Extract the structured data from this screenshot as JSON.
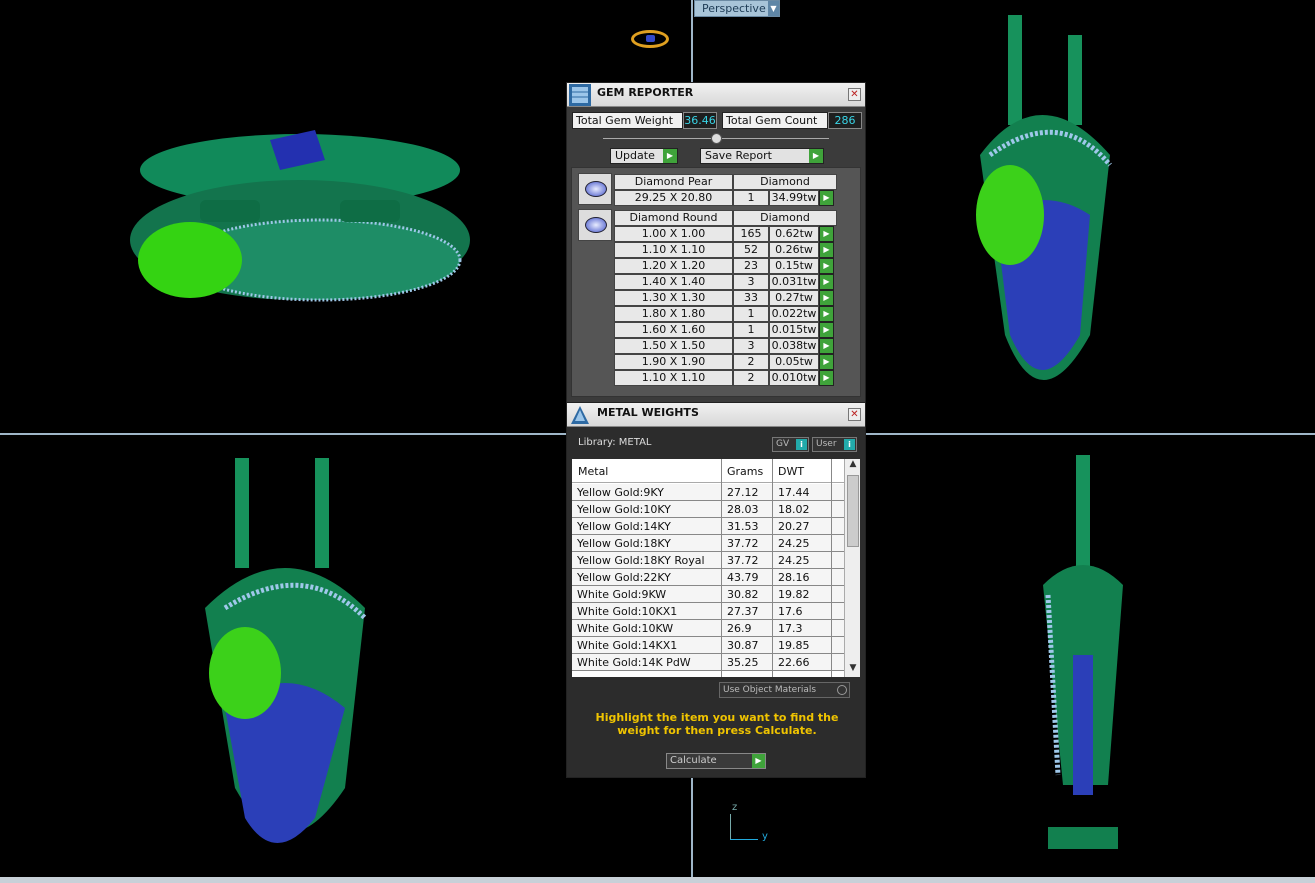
{
  "viewport": {
    "label": "Perspective",
    "axis_z": "z",
    "axis_y": "y"
  },
  "gem_reporter": {
    "title": "GEM REPORTER",
    "total_weight_label": "Total Gem Weight",
    "total_weight": "36.46",
    "total_count_label": "Total Gem Count",
    "total_count": "286",
    "update_label": "Update",
    "save_label": "Save Report",
    "pear": {
      "name": "Diamond Pear",
      "material": "Diamond",
      "size": "29.25 X 20.80",
      "qty": "1",
      "wt": "34.99tw"
    },
    "round": {
      "name": "Diamond Round",
      "material": "Diamond",
      "rows": [
        {
          "size": "1.00 X 1.00",
          "qty": "165",
          "wt": "0.62tw"
        },
        {
          "size": "1.10 X 1.10",
          "qty": "52",
          "wt": "0.26tw"
        },
        {
          "size": "1.20 X 1.20",
          "qty": "23",
          "wt": "0.15tw"
        },
        {
          "size": "1.40 X 1.40",
          "qty": "3",
          "wt": "0.031tw"
        },
        {
          "size": "1.30 X 1.30",
          "qty": "33",
          "wt": "0.27tw"
        },
        {
          "size": "1.80 X 1.80",
          "qty": "1",
          "wt": "0.022tw"
        },
        {
          "size": "1.60 X 1.60",
          "qty": "1",
          "wt": "0.015tw"
        },
        {
          "size": "1.50 X 1.50",
          "qty": "3",
          "wt": "0.038tw"
        },
        {
          "size": "1.90 X 1.90",
          "qty": "2",
          "wt": "0.05tw"
        },
        {
          "size": "1.10 X 1.10",
          "qty": "2",
          "wt": "0.010tw"
        }
      ]
    }
  },
  "metal_weights": {
    "title": "METAL WEIGHTS",
    "library_label": "Library: METAL",
    "gv_label": "GV",
    "user_label": "User",
    "headers": {
      "metal": "Metal",
      "grams": "Grams",
      "dwt": "DWT"
    },
    "rows": [
      {
        "metal": "Yellow Gold:9KY",
        "grams": "27.12",
        "dwt": "17.44"
      },
      {
        "metal": "Yellow Gold:10KY",
        "grams": "28.03",
        "dwt": "18.02"
      },
      {
        "metal": "Yellow Gold:14KY",
        "grams": "31.53",
        "dwt": "20.27"
      },
      {
        "metal": "Yellow Gold:18KY",
        "grams": "37.72",
        "dwt": "24.25"
      },
      {
        "metal": "Yellow Gold:18KY Royal",
        "grams": "37.72",
        "dwt": "24.25"
      },
      {
        "metal": "Yellow Gold:22KY",
        "grams": "43.79",
        "dwt": "28.16"
      },
      {
        "metal": "White Gold:9KW",
        "grams": "30.82",
        "dwt": "19.82"
      },
      {
        "metal": "White Gold:10KX1",
        "grams": "27.37",
        "dwt": "17.6"
      },
      {
        "metal": "White Gold:10KW",
        "grams": "26.9",
        "dwt": "17.3"
      },
      {
        "metal": "White Gold:14KX1",
        "grams": "30.87",
        "dwt": "19.85"
      },
      {
        "metal": "White Gold:14K PdW",
        "grams": "35.25",
        "dwt": "22.66"
      }
    ],
    "use_object_label": "Use Object Materials",
    "hint": "Highlight the item you want to find the weight for then press Calculate.",
    "calculate_label": "Calculate"
  }
}
